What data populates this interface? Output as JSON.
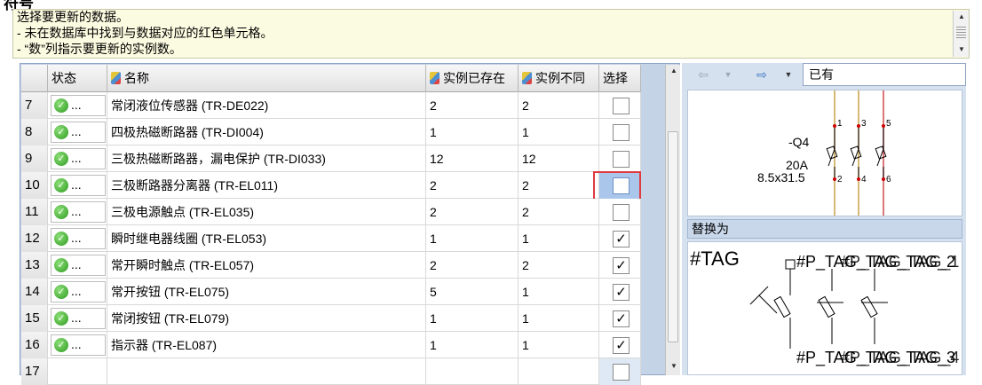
{
  "header": {
    "title": "符号",
    "lines": [
      "选择要更新的数据。",
      "- 未在数据库中找到与数据对应的红色单元格。",
      "- “数”列指示要更新的实例数。"
    ]
  },
  "grid": {
    "columns": [
      "状态",
      "名称",
      "实例已存在",
      "实例不同",
      "选择"
    ],
    "rows": [
      {
        "num": "7",
        "status": "...",
        "name": "常闭液位传感器 (TR-DE022)",
        "exist": "2",
        "diff": "2",
        "checked": false
      },
      {
        "num": "8",
        "status": "...",
        "name": "四极热磁断路器 (TR-DI004)",
        "exist": "1",
        "diff": "1",
        "checked": false
      },
      {
        "num": "9",
        "status": "...",
        "name": "三极热磁断路器，漏电保护 (TR-DI033)",
        "exist": "12",
        "diff": "12",
        "checked": false
      },
      {
        "num": "10",
        "status": "...",
        "name": "三极断路器分离器 (TR-EL011)",
        "exist": "2",
        "diff": "2",
        "checked": false
      },
      {
        "num": "11",
        "status": "...",
        "name": "三极电源触点 (TR-EL035)",
        "exist": "2",
        "diff": "2",
        "checked": false
      },
      {
        "num": "12",
        "status": "...",
        "name": "瞬时继电器线圈 (TR-EL053)",
        "exist": "1",
        "diff": "1",
        "checked": true
      },
      {
        "num": "13",
        "status": "...",
        "name": "常开瞬时触点 (TR-EL057)",
        "exist": "2",
        "diff": "2",
        "checked": true
      },
      {
        "num": "14",
        "status": "...",
        "name": "常开按钮 (TR-EL075)",
        "exist": "5",
        "diff": "1",
        "checked": true
      },
      {
        "num": "15",
        "status": "...",
        "name": "常闭按钮 (TR-EL079)",
        "exist": "1",
        "diff": "1",
        "checked": true
      },
      {
        "num": "16",
        "status": "...",
        "name": "指示器 (TR-EL087)",
        "exist": "1",
        "diff": "1",
        "checked": true
      },
      {
        "num": "17",
        "status": "",
        "name": "",
        "exist": "",
        "diff": "",
        "checked": false
      }
    ]
  },
  "right": {
    "nav_select": "已有",
    "replace_label": "替换为",
    "preview1": {
      "tag": "-Q4",
      "rating": "20A",
      "size": "8.5x31.5",
      "pins": [
        "1",
        "3",
        "5",
        "2",
        "4",
        "6"
      ]
    },
    "preview2": {
      "tag": "#TAG",
      "p_tag_top": "#P_TAG_TAG_TAG_2",
      "p_tag_bottom": "#P_TAG_TAG_TAG_3",
      "overlap_top": "#P_TAG_TAG_1",
      "overlap_bottom": "#P_TAG_TAG_4"
    }
  },
  "colors": {
    "accent_red": "#e0393e",
    "selection": "#aac6ea",
    "panel_bg": "#c5d3e6",
    "header_bg": "#fbfbe1"
  }
}
